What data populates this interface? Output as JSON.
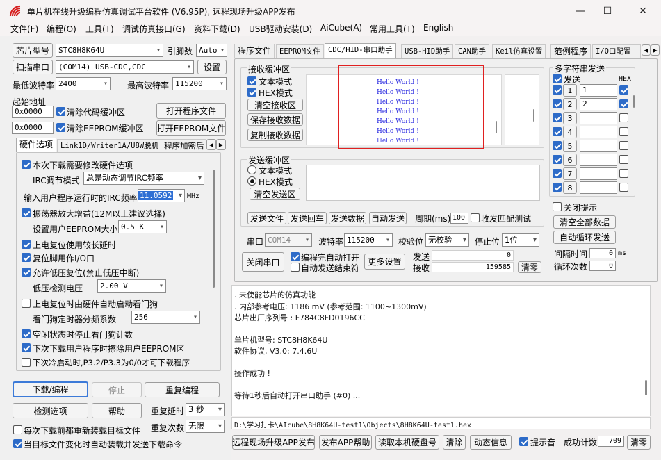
{
  "window": {
    "title": "单片机在线升级编程仿真调试平台软件 (V6.95P), 远程现场升级APP发布",
    "minimize": "—",
    "maximize": "☐",
    "close": "✕"
  },
  "menu": [
    "文件(F)",
    "编程(O)",
    "工具(T)",
    "调试仿真接口(G)",
    "资料下载(D)",
    "USB驱动安装(D)",
    "AiCube(A)",
    "常用工具(T)",
    "English"
  ],
  "left": {
    "chip_btn": "芯片型号",
    "chip_value": "STC8H8K64U",
    "pin_label": "引脚数",
    "pin_value": "Auto",
    "scan_btn": "扫描串口",
    "port_value": "(COM14) USB-CDC,CDC",
    "settings_btn": "设置",
    "min_baud_label": "最低波特率",
    "min_baud": "2400",
    "max_baud_label": "最高波特率",
    "max_baud": "115200",
    "start_addr_label": "起始地址",
    "addr1": "0x0000",
    "clear_code": "清除代码缓冲区",
    "open_prog": "打开程序文件",
    "addr2": "0x0000",
    "clear_eeprom": "清除EEPROM缓冲区",
    "open_eeprom": "打开EEPROM文件",
    "tabs": [
      "硬件选项",
      "Link1D/Writer1A/U8W脱机",
      "程序加密后"
    ],
    "opt_modify_hw": "本次下载需要修改硬件选项",
    "irc_mode_label": "IRC调节模式",
    "irc_mode_value": "总是动态调节IRC频率",
    "irc_freq_label": "输入用户程序运行时的IRC频率",
    "irc_freq_value": "11.0592",
    "irc_unit": "MHz",
    "opt_osc": "振荡器放大增益(12M以上建议选择)",
    "eeprom_size_label": "设置用户EEPROM大小",
    "eeprom_size": "0.5 K",
    "opt_power_delay": "上电复位使用较长延时",
    "opt_reset_pin": "复位脚用作I/O口",
    "opt_lvr": "允许低压复位(禁止低压中断)",
    "lvd_label": "低压检测电压",
    "lvd_value": "2.00 V",
    "opt_wdt": "上电复位时由硬件自动启动看门狗",
    "wdt_div_label": "看门狗定时器分频系数",
    "wdt_div": "256",
    "opt_idle_wdt": "空闲状态时停止看门狗计数",
    "opt_erase_eeprom": "下次下载用户程序时擦除用户EEPROM区",
    "opt_p32": "下次冷启动时,P3.2/P3.3为0/0才可下载程序",
    "download_btn": "下载/编程",
    "stop_btn": "停止",
    "repeat_btn": "重复编程",
    "check_btn": "检测选项",
    "help_btn": "帮助",
    "repeat_delay_label": "重复延时",
    "repeat_delay": "3 秒",
    "repeat_count_label": "重复次数",
    "repeat_count": "无限",
    "reload_each": "每次下载前都重新装载目标文件",
    "auto_reload": "当目标文件变化时自动装载并发送下载命令"
  },
  "right_tabs": [
    "程序文件",
    "EEPROM文件",
    "CDC/HID-串口助手",
    "USB-HID助手",
    "CAN助手",
    "Keil仿真设置",
    "范例程序",
    "I/O口配置"
  ],
  "serial": {
    "recv_title": "接收缓冲区",
    "text_mode": "文本模式",
    "hex_mode": "HEX模式",
    "clear_recv": "清空接收区",
    "save_recv": "保存接收数据",
    "copy_recv": "复制接收数据",
    "recv_lines": [
      "Hello World !",
      "Hello World !",
      "Hello World !",
      "Hello World !",
      "Hello World !",
      "Hello World !",
      "Hello World !"
    ],
    "send_title": "发送缓冲区",
    "send_text_mode": "文本模式",
    "send_hex_mode": "HEX模式",
    "clear_send": "清空发送区",
    "send_file": "发送文件",
    "send_back": "发送回车",
    "send_data": "发送数据",
    "auto_send": "自动发送",
    "period_label": "周期(ms)",
    "period": "100",
    "match_test": "收发匹配测试",
    "port_label": "串口",
    "port": "COM14",
    "baud_label": "波特率",
    "baud": "115200",
    "parity_label": "校验位",
    "parity": "无校验",
    "stop_label": "停止位",
    "stop": "1位",
    "close_port": "关闭串口",
    "auto_open": "编程完自动打开",
    "auto_end": "自动发送结束符",
    "more_settings": "更多设置",
    "send_count_label": "发送",
    "send_count": "0",
    "recv_count_label": "接收",
    "recv_count": "159585",
    "clear_count": "清零"
  },
  "multi": {
    "title": "多字符串发送",
    "send_label": "发送",
    "hex_label": "HEX",
    "rows": [
      {
        "num": "1",
        "value": "1"
      },
      {
        "num": "2",
        "value": "2"
      },
      {
        "num": "3",
        "value": ""
      },
      {
        "num": "4",
        "value": ""
      },
      {
        "num": "5",
        "value": ""
      },
      {
        "num": "6",
        "value": ""
      },
      {
        "num": "7",
        "value": ""
      },
      {
        "num": "8",
        "value": ""
      }
    ],
    "close_hint": "关闭提示",
    "clear_all": "清空全部数据",
    "auto_loop": "自动循环发送",
    "interval_label": "间隔时间",
    "interval": "0",
    "interval_unit": "ms",
    "loop_label": "循环次数",
    "loop": "0"
  },
  "log": {
    "lines": [
      "  . 未使能芯片的仿真功能",
      "  . 内部参考电压: 1186 mV (参考范围: 1100~1300mV)",
      "芯片出厂序列号 : F784C8FD0196CC",
      "",
      "  单片机型号: STC8H8K64U",
      "  软件协议, V3.0: 7.4.6U",
      "",
      "操作成功 !",
      "",
      "等待1秒后自动打开串口助手 (#0) ..."
    ],
    "path": "D:\\学习打卡\\AIcube\\8H8K64U-test1\\Objects\\8H8K64U-test1.hex"
  },
  "bottom": {
    "remote_upgrade": "远程现场升级APP发布",
    "publish_help": "发布APP帮助",
    "read_disk": "读取本机硬盘号",
    "clear": "清除",
    "dyn_info": "动态信息",
    "beep": "提示音",
    "success_label": "成功计数",
    "success_count": "709",
    "clear_zero": "清零"
  }
}
